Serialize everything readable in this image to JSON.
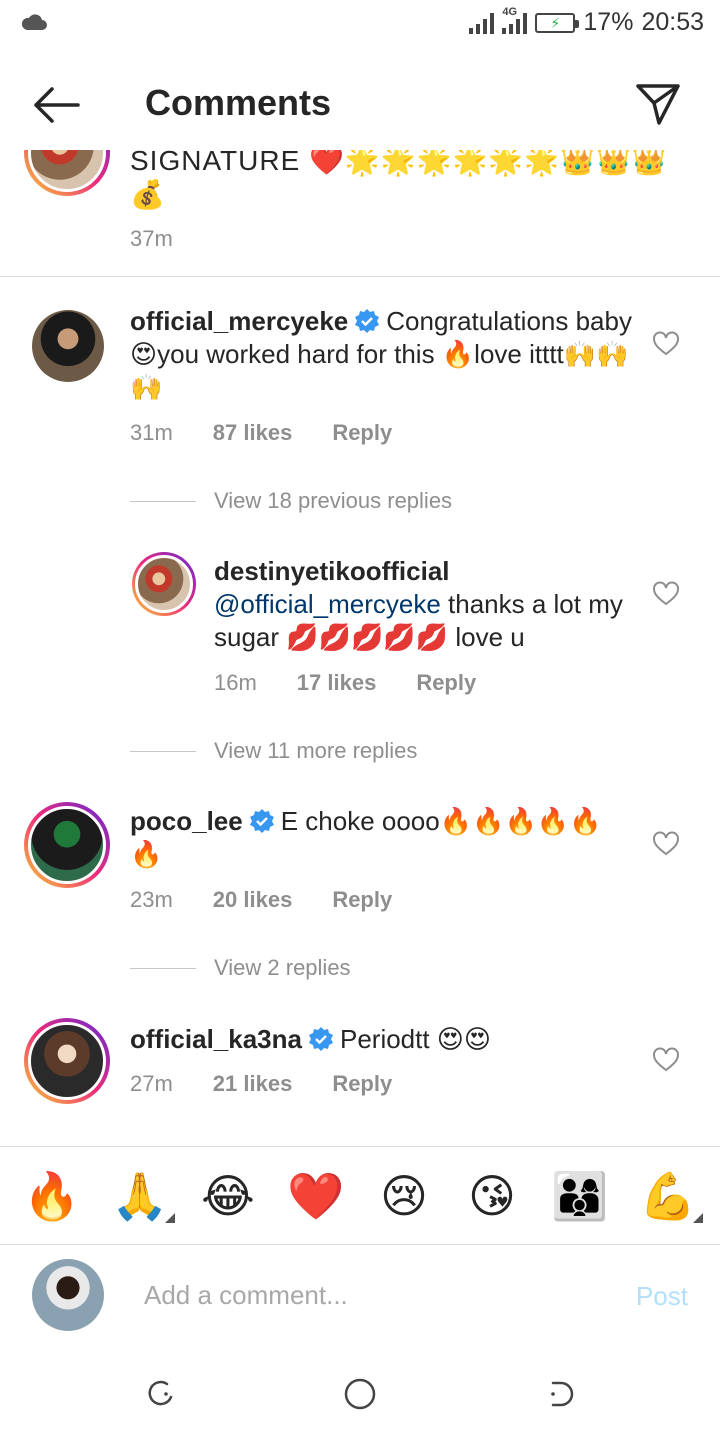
{
  "status_bar": {
    "network_type": "4G",
    "battery_percent": "17%",
    "time": "20:53"
  },
  "header": {
    "title": "Comments",
    "back_icon": "arrow-left-icon",
    "share_icon": "paper-plane-icon"
  },
  "caption": {
    "text_line1": "SIGNATURE ❤️🌟🌟🌟🌟🌟🌟👑👑👑",
    "text_line2": "💰",
    "time": "37m"
  },
  "comments": [
    {
      "username": "official_mercyeke",
      "verified": true,
      "text": "Congratulations baby 😍you worked hard for this 🔥love itttt🙌🙌🙌",
      "time": "31m",
      "likes": "87 likes",
      "reply_label": "Reply"
    },
    {
      "username": "destinyetikoofficial",
      "verified": false,
      "mention": "@official_mercyeke",
      "text": "thanks a lot my sugar 💋💋💋💋💋 love u",
      "time": "16m",
      "likes": "17 likes",
      "reply_label": "Reply"
    },
    {
      "username": "poco_lee",
      "verified": true,
      "text": "E choke oooo🔥🔥🔥🔥🔥🔥",
      "time": "23m",
      "likes": "20 likes",
      "reply_label": "Reply"
    },
    {
      "username": "official_ka3na",
      "verified": true,
      "text": "Periodtt 😍😍",
      "time": "27m",
      "likes": "21 likes",
      "reply_label": "Reply"
    }
  ],
  "reply_links": {
    "previous_replies": "View 18 previous replies",
    "more_replies": "View 11 more replies",
    "poco_replies": "View 2 replies"
  },
  "emoji_bar": [
    "🔥",
    "🙏",
    "😂",
    "❤️",
    "😢",
    "😘",
    "👨‍👩‍👦",
    "💪"
  ],
  "composer": {
    "placeholder": "Add a comment...",
    "post_label": "Post"
  },
  "colors": {
    "text": "#262626",
    "secondary": "#8e8e8e",
    "link": "#00376b",
    "verified": "#3897f0",
    "post_disabled": "#b2dffc"
  }
}
